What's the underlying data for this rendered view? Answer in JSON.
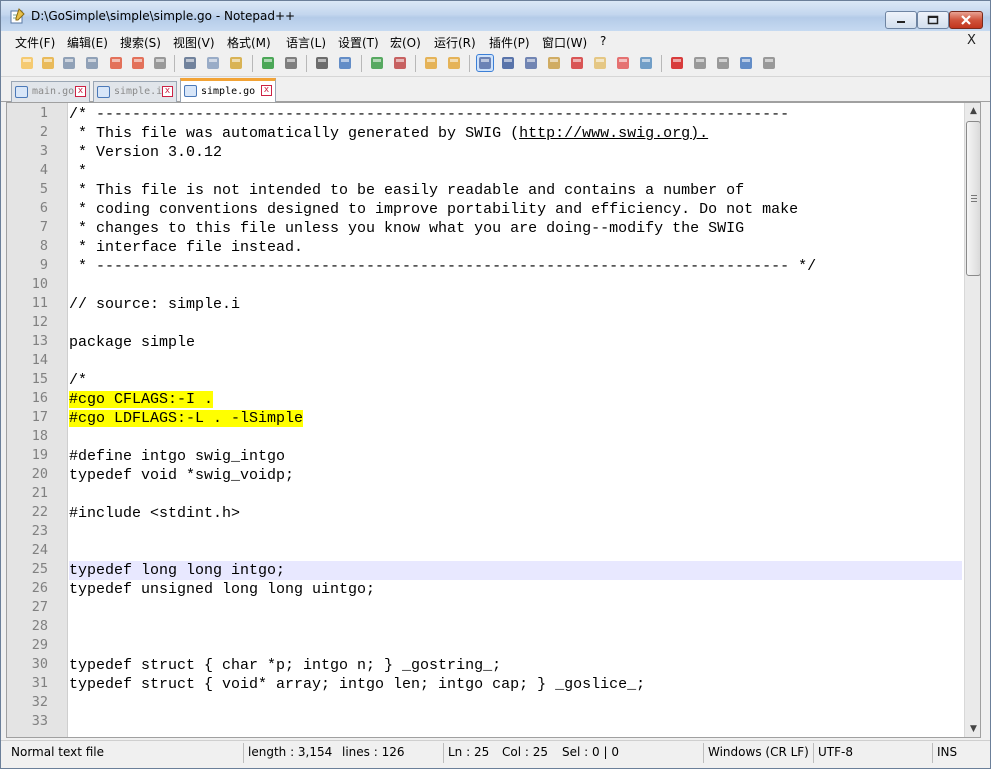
{
  "window": {
    "title": "D:\\GoSimple\\simple\\simple.go - Notepad++",
    "min_glyph": "─",
    "max_glyph": "▫",
    "close_glyph": "✕"
  },
  "menu": {
    "items": [
      "文件(F)",
      "编辑(E)",
      "搜索(S)",
      "视图(V)",
      "格式(M)",
      "语言(L)",
      "设置(T)",
      "宏(O)",
      "运行(R)",
      "插件(P)",
      "窗口(W)",
      "?"
    ],
    "close_glyph": "X"
  },
  "toolbar": {
    "icons": [
      "new-file-icon",
      "open-file-icon",
      "save-icon",
      "save-all-icon",
      "close-icon",
      "close-all-icon",
      "print-icon",
      "cut-icon",
      "copy-icon",
      "paste-icon",
      "undo-icon",
      "redo-icon",
      "find-icon",
      "replace-icon",
      "zoom-in-icon",
      "zoom-out-icon",
      "sync-vertical-icon",
      "sync-horizontal-icon",
      "word-wrap-icon",
      "show-all-chars-icon",
      "indent-guide-icon",
      "doc-map-icon",
      "function-list-icon",
      "folder-workspace-icon",
      "monitoring-icon",
      "view-icon",
      "macro-record-icon",
      "macro-stop-icon",
      "macro-play-icon",
      "macro-run-multiple-icon",
      "macro-save-icon"
    ]
  },
  "tabs": [
    {
      "label": "main.go",
      "active": false,
      "close_glyph": "x"
    },
    {
      "label": "simple.i",
      "active": false,
      "close_glyph": "x"
    },
    {
      "label": "simple.go",
      "active": true,
      "close_glyph": "x"
    }
  ],
  "editor": {
    "current_line": 25,
    "lines": [
      "/* -----------------------------------------------------------------------------",
      " * This file was automatically generated by SWIG (http://www.swig.org).",
      " * Version 3.0.12",
      " *",
      " * This file is not intended to be easily readable and contains a number of",
      " * coding conventions designed to improve portability and efficiency. Do not make",
      " * changes to this file unless you know what you are doing--modify the SWIG",
      " * interface file instead.",
      " * ----------------------------------------------------------------------------- */",
      "",
      "// source: simple.i",
      "",
      "package simple",
      "",
      "/*",
      "#cgo CFLAGS:-I .",
      "#cgo LDFLAGS:-L . -lSimple",
      "",
      "#define intgo swig_intgo",
      "typedef void *swig_voidp;",
      "",
      "#include <stdint.h>",
      "",
      "",
      "typedef long long intgo;",
      "typedef unsigned long long uintgo;",
      "",
      "",
      "",
      "typedef struct { char *p; intgo n; } _gostring_;",
      "typedef struct { void* array; intgo len; intgo cap; } _goslice_;",
      "",
      ""
    ],
    "line_numbers": [
      "1",
      "2",
      "3",
      "4",
      "5",
      "6",
      "7",
      "8",
      "9",
      "10",
      "11",
      "12",
      "13",
      "14",
      "15",
      "16",
      "17",
      "18",
      "19",
      "20",
      "21",
      "22",
      "23",
      "24",
      "25",
      "26",
      "27",
      "28",
      "29",
      "30",
      "31",
      "32",
      "33"
    ],
    "highlighted_lines": [
      16,
      17
    ],
    "link_text": "http://www.swig.org)."
  },
  "statusbar": {
    "file_type": "Normal text file",
    "length": "length : 3,154",
    "lines": "lines : 126",
    "ln": "Ln : 25",
    "col": "Col : 25",
    "sel": "Sel : 0 | 0",
    "eol": "Windows (CR LF)",
    "encoding": "UTF-8",
    "mode": "INS"
  },
  "colors": {
    "highlight": "#ffff00",
    "current_line": "#e8e8ff",
    "active_tab_accent": "#f2a336"
  }
}
